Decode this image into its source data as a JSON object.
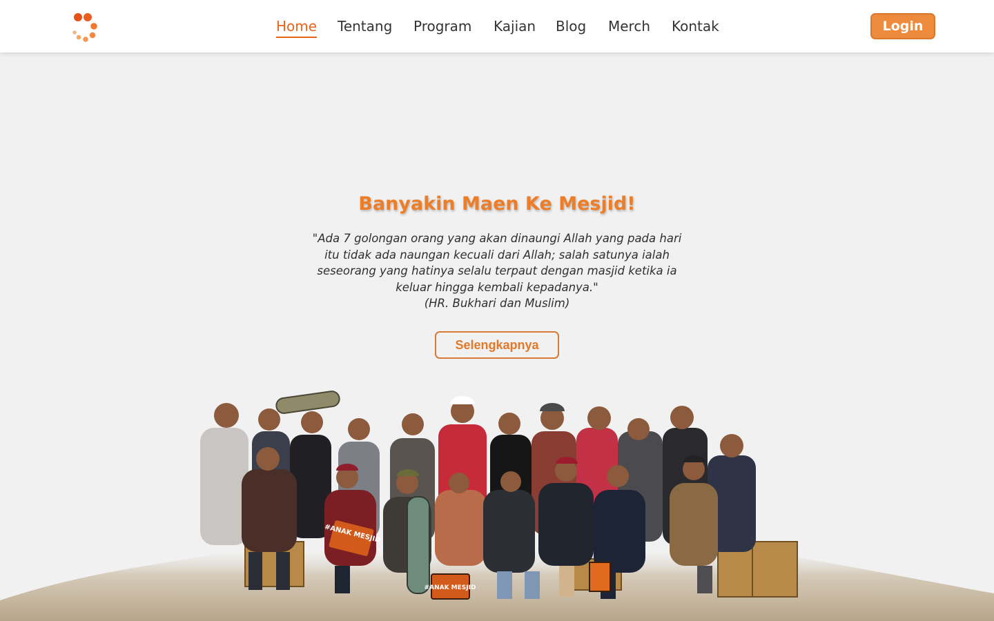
{
  "header": {
    "logo_icon": "loader-dots-logo",
    "nav": [
      {
        "label": "Home",
        "active": true
      },
      {
        "label": "Tentang",
        "active": false
      },
      {
        "label": "Program",
        "active": false
      },
      {
        "label": "Kajian",
        "active": false
      },
      {
        "label": "Blog",
        "active": false
      },
      {
        "label": "Merch",
        "active": false
      },
      {
        "label": "Kontak",
        "active": false
      }
    ],
    "login_label": "Login"
  },
  "hero": {
    "title": "Banyakin Maen Ke Mesjid!",
    "quote_lines": [
      "\"Ada 7 golongan orang yang akan dinaungi Allah yang pada hari",
      "itu tidak ada naungan kecuali dari Allah; salah satunya ialah",
      "seseorang yang hatinya selalu terpaut dengan masjid ketika ia",
      "keluar hingga kembali kepadanya.\""
    ],
    "citation": "(HR. Bukhari dan Muslim)",
    "cta_label": "Selengkapnya",
    "image_box_labels": [
      "#ANAK MESJID",
      "#ANAK MESJID"
    ]
  },
  "colors": {
    "accent": "#ee7d27",
    "button_fill": "#ee8a3c",
    "background": "#f1f1f1",
    "navbar": "#ffffff"
  }
}
